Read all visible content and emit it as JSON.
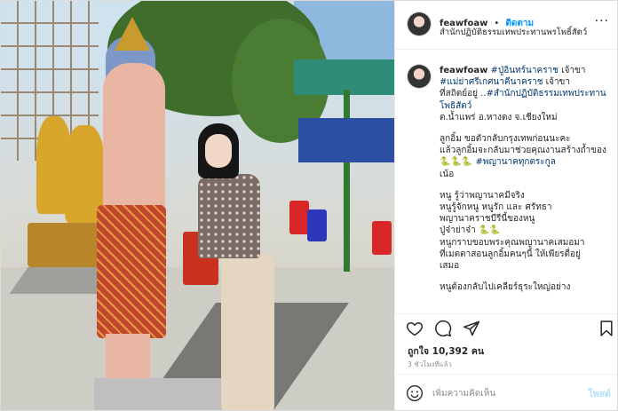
{
  "post": {
    "header": {
      "username": "feawfoaw",
      "separator": "•",
      "follow_label": "ติดตาม",
      "location": "สำนักปฏิบัติธรรมเทพประทานพรโพธิ์สัตว์"
    },
    "caption": {
      "username": "feawfoaw",
      "line1_tag": "#ปู่อินทร์นาคราช",
      "line1_text": " เจ้าขา",
      "line2_tag": "#แม่ย่าศรีเกศนาคีนาคราช",
      "line2_text": " เจ้าขา",
      "line3_text": "ที่สถิตย์อยู่ ..",
      "line3_tag": "#สำนักปฏิบัติธรรมเทพประทานโพธิสัตว์",
      "line4": "ต.น้ำแพร่ อ.หางดง จ.เชียงใหม่",
      "para2": "ลูกอิ้ม ขอตัวกลับกรุงเทพก่อนนะคะ\nแล้วลูกอิ้มจะกลับมาช่วยคุณงานสร้างถ้ำของ",
      "emoji": "🐍🐍🐍",
      "para2_tag": "#พญานาคทุกตระกูล",
      "para2_end": "เน้อ",
      "para3": "หนู รู้ว่าพญานาคมีจริง\nหนูรู้จักหนู หนูรัก และ ศรัทธา\nพญานาคราชบีรีนี้ของหนู\nปู่จ๋าย่าจ๋า",
      "para3_emoji": "🐍🐍",
      "para3_end": "\nหนูกราบขอบพระคุณพญานาคเสมอมา\nที่เมตตาสอนลูกอิ้มคนๆนี้ ให้เพียรตื่อยู่\nเสมอ",
      "para4": "หนูต้องกลับไปเคลียร์ธุระใหญ่อย่าง"
    },
    "likes_text": "ถูกใจ 10,392 คน",
    "time_ago": "3 ชั่วโมงที่แล้ว",
    "comment_placeholder": "เพิ่มความคิดเห็น",
    "post_button": "โพสต์"
  },
  "icons": {
    "like": "heart-icon",
    "comment": "comment-bubble-icon",
    "share": "paper-plane-icon",
    "save": "bookmark-icon",
    "emoji": "smiley-icon"
  },
  "colors": {
    "link": "#0095f6",
    "hashtag": "#00376b",
    "muted": "#8e8e8e",
    "post_disabled": "#b2dffc"
  }
}
